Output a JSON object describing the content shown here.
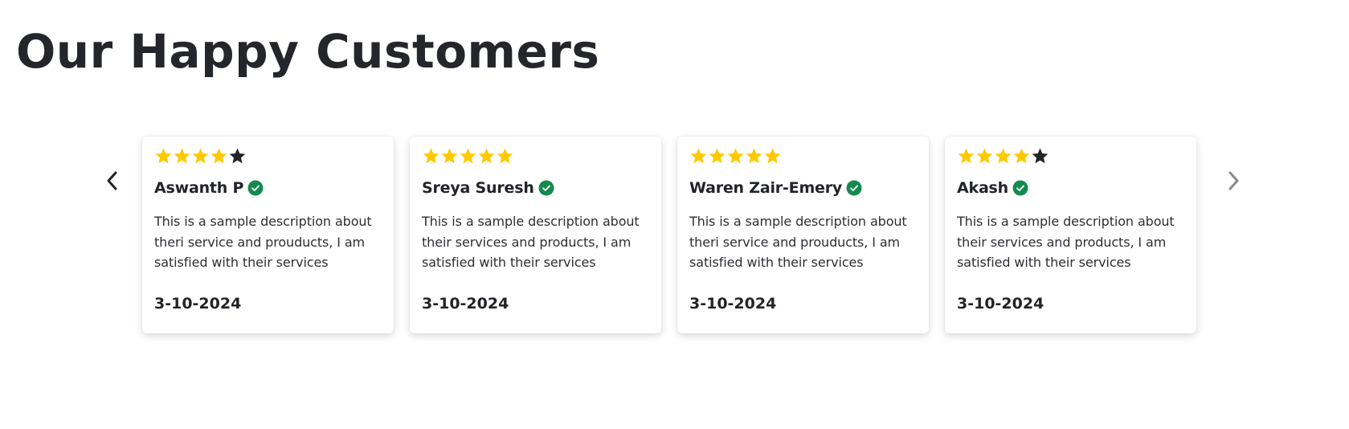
{
  "section": {
    "title": "Our Happy Customers"
  },
  "carousel": {
    "prev_icon": "chevron-left-icon",
    "next_icon": "chevron-right-icon"
  },
  "colors": {
    "star_filled": "#FFC901",
    "star_empty": "#222428",
    "verified": "#148A4C",
    "prev_arrow": "#222428",
    "next_arrow": "#8A8A8A"
  },
  "reviews": [
    {
      "rating": 4,
      "max_rating": 5,
      "name": "Aswanth P",
      "verified": true,
      "text": "This is a sample description about theri service and prouducts, I am satisfied with their services",
      "date": "3-10-2024"
    },
    {
      "rating": 5,
      "max_rating": 5,
      "name": "Sreya Suresh",
      "verified": true,
      "text": "This is a sample description about their services and products, I am satisfied with their services",
      "date": "3-10-2024"
    },
    {
      "rating": 5,
      "max_rating": 5,
      "name": "Waren Zair-Emery",
      "verified": true,
      "text": "This is a sample description about theri service and prouducts, I am satisfied with their services",
      "date": "3-10-2024"
    },
    {
      "rating": 4,
      "max_rating": 5,
      "name": "Akash",
      "verified": true,
      "text": "This is a sample description about their services and products, I am satisfied with their services",
      "date": "3-10-2024"
    }
  ]
}
